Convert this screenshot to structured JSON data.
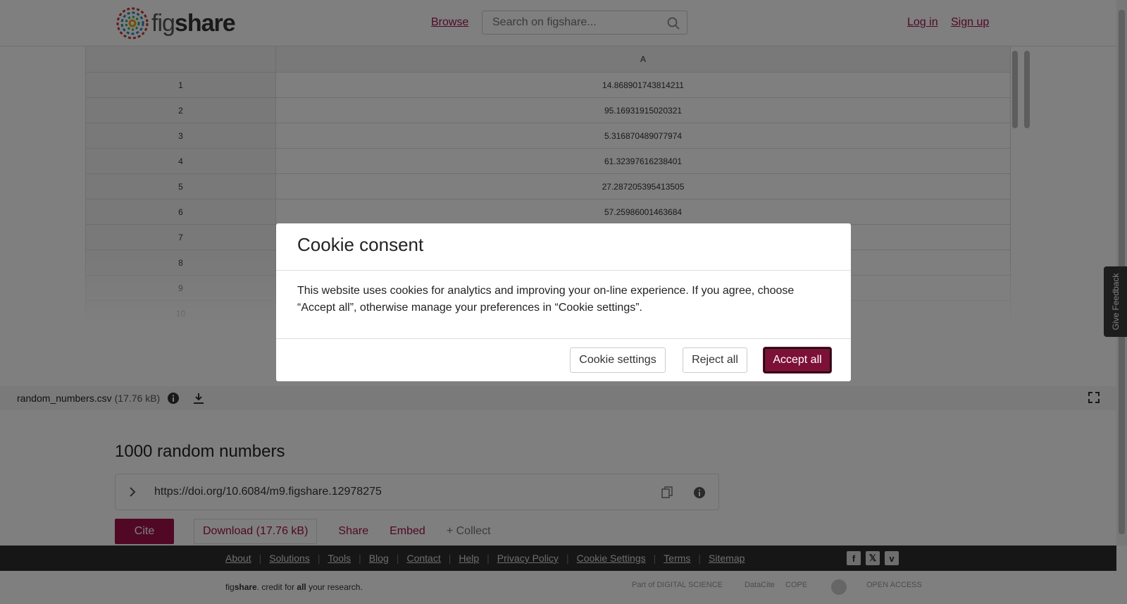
{
  "header": {
    "logo_text": "fig",
    "logo_bold": "share",
    "browse": "Browse",
    "search_placeholder": "Search on figshare...",
    "login": "Log in",
    "signup": "Sign up"
  },
  "preview": {
    "column_header": "A",
    "rows": [
      {
        "idx": "1",
        "value": "14.868901743814211"
      },
      {
        "idx": "2",
        "value": "95.16931915020321"
      },
      {
        "idx": "3",
        "value": "5.316870489077974"
      },
      {
        "idx": "4",
        "value": "61.32397616238401"
      },
      {
        "idx": "5",
        "value": "27.287205395413505"
      },
      {
        "idx": "6",
        "value": "57.25986001463684"
      },
      {
        "idx": "7",
        "value": ""
      },
      {
        "idx": "8",
        "value": ""
      },
      {
        "idx": "9",
        "value": ""
      },
      {
        "idx": "10",
        "value": ""
      }
    ]
  },
  "file": {
    "name": "random_numbers.csv",
    "size": "(17.76 kB)"
  },
  "item": {
    "title": "1000 random numbers",
    "doi": "https://doi.org/10.6084/m9.figshare.12978275",
    "cite": "Cite",
    "download": "Download",
    "download_size": "(17.76 kB)",
    "share": "Share",
    "embed": "Embed",
    "collect": "+ Collect"
  },
  "footer": {
    "links": [
      "About",
      "Solutions",
      "Tools",
      "Blog",
      "Contact",
      "Help",
      "Privacy Policy",
      "Cookie Settings",
      "Terms",
      "Sitemap"
    ],
    "tagline_pre": "fig",
    "tagline_bold": "share",
    "tagline_mid": ". credit for ",
    "tagline_all": "all",
    "tagline_end": " your research.",
    "partners": [
      "Part of DIGITAL SCIENCE",
      "DataCite",
      "COPE",
      "",
      "OPEN ACCESS"
    ]
  },
  "feedback": "Give Feedback",
  "modal": {
    "title": "Cookie consent",
    "body": "This website uses cookies for analytics and improving your on-line experience. If you agree, choose “Accept all”, otherwise manage your preferences in “Cookie settings”.",
    "settings": "Cookie settings",
    "reject": "Reject all",
    "accept": "Accept all"
  },
  "colors": {
    "brand": "#a0114a",
    "accept_button": "#7d1037",
    "footer_bg": "#2d2d2d"
  }
}
